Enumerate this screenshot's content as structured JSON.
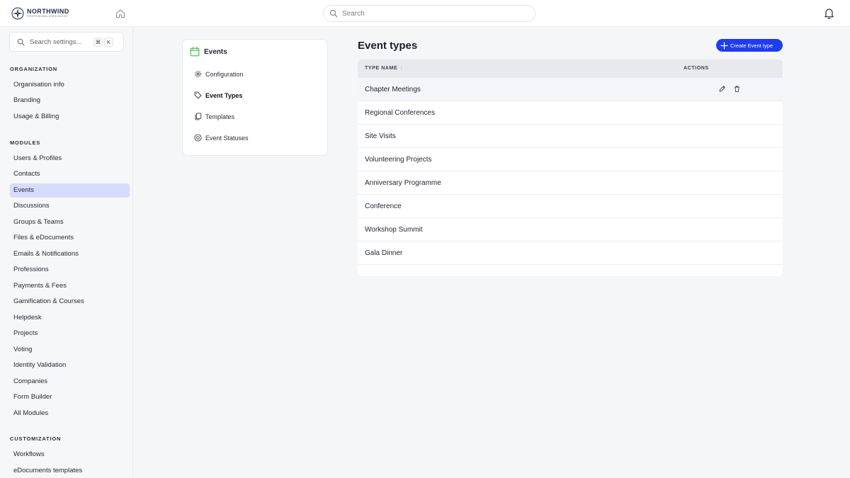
{
  "brand": {
    "name": "NORTHWIND",
    "tagline": "PROFESSIONAL ASSOCIATION"
  },
  "header": {
    "search_placeholder": "Search"
  },
  "sidebar": {
    "search_placeholder": "Search settings...",
    "shortcut_keys": [
      "⌘",
      "K"
    ],
    "sections": [
      {
        "title": "ORGANIZATION",
        "items": [
          "Organisation info",
          "Branding",
          "Usage & Billing"
        ]
      },
      {
        "title": "MODULES",
        "items": [
          "Users & Profiles",
          "Contacts",
          "Events",
          "Discussions",
          "Groups & Teams",
          "Files & eDocuments",
          "Emails & Notifications",
          "Professions",
          "Payments & Fees",
          "Gamification & Courses",
          "Helpdesk",
          "Projects",
          "Voting",
          "Identity Validation",
          "Companies",
          "Form Builder",
          "All Modules"
        ]
      },
      {
        "title": "CUSTOMIZATION",
        "items": [
          "Workflows",
          "eDocuments templates"
        ]
      }
    ],
    "active_item": "Events"
  },
  "submenu": {
    "title": "Events",
    "items": [
      {
        "label": "Configuration",
        "icon": "gear-icon"
      },
      {
        "label": "Event Types",
        "icon": "tag-icon",
        "active": true
      },
      {
        "label": "Templates",
        "icon": "copy-icon"
      },
      {
        "label": "Event Statuses",
        "icon": "status-circle-icon"
      }
    ]
  },
  "main": {
    "title": "Event types",
    "create_label": "Create Event type",
    "columns": {
      "name": "TYPE NAME",
      "sort_indicator": "↕",
      "actions": "ACTIONS"
    },
    "rows": [
      "Chapter Meetings",
      "Regional Conferences",
      "Site Visits",
      "Volunteering Projects",
      "Anniversary Programme",
      "Conference",
      "Workshop Summit",
      "Gala Dinner"
    ]
  },
  "colors": {
    "accent": "#1f3cf0",
    "active_nav": "#d6dcfb",
    "calendar_icon": "#3fb54b"
  }
}
